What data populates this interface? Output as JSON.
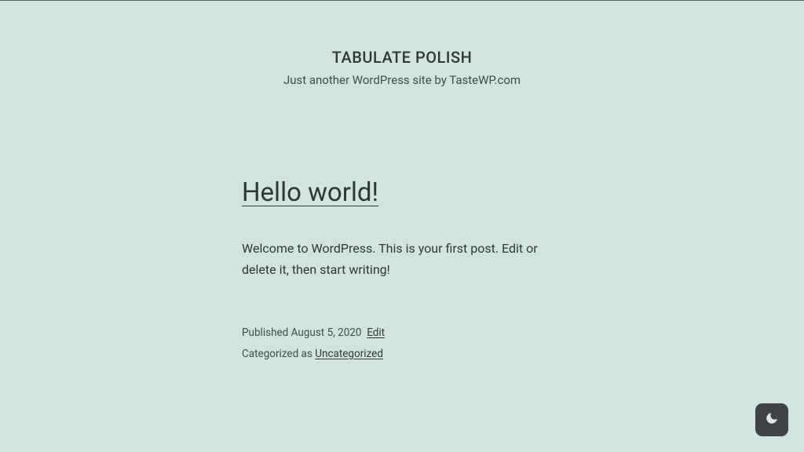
{
  "header": {
    "site_title": "TABULATE POLISH",
    "tagline": "Just another WordPress site by TasteWP.com"
  },
  "post": {
    "title": "Hello world!",
    "body": "Welcome to WordPress. This is your first post. Edit or delete it, then start writing!",
    "published_label": "Published",
    "published_date": "August 5, 2020",
    "edit_label": "Edit",
    "categorized_label": "Categorized as",
    "category": "Uncategorized"
  }
}
